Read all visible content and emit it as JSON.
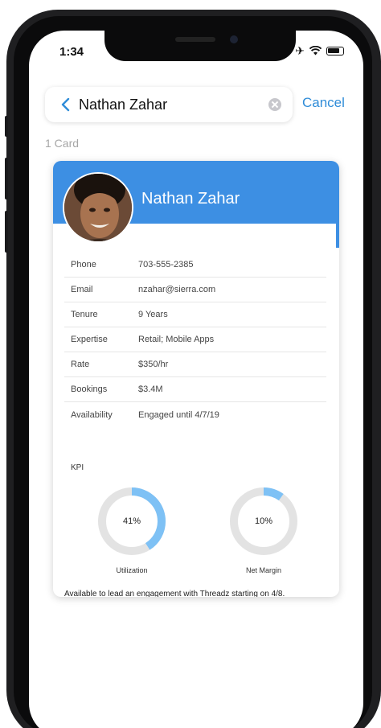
{
  "status_bar": {
    "time": "1:34",
    "airplane_icon": "airplane-icon",
    "wifi_icon": "wifi-icon",
    "battery_icon": "battery-icon"
  },
  "search": {
    "value": "Nathan Zahar",
    "cancel_label": "Cancel",
    "back_icon": "chevron-left-icon",
    "clear_icon": "clear-icon"
  },
  "results": {
    "count_label": "1 Card"
  },
  "card": {
    "name": "Nathan Zahar",
    "header_color": "#3d8fe3",
    "fields": [
      {
        "label": "Phone",
        "value": "703-555-2385"
      },
      {
        "label": "Email",
        "value": "nzahar@sierra.com"
      },
      {
        "label": "Tenure",
        "value": "9 Years"
      },
      {
        "label": "Expertise",
        "value": "Retail; Mobile Apps"
      },
      {
        "label": "Rate",
        "value": "$350/hr"
      },
      {
        "label": "Bookings",
        "value": "$3.4M"
      },
      {
        "label": "Availability",
        "value": "Engaged until 4/7/19"
      }
    ],
    "kpi": {
      "label": "KPI",
      "gauges": [
        {
          "label": "Utilization",
          "value": 41,
          "display": "41%"
        },
        {
          "label": "Net Margin",
          "value": 10,
          "display": "10%"
        }
      ],
      "track_color": "#e3e3e3",
      "fill_color": "#7ec1f5"
    },
    "note": "Available to lead an engagement with Threadz starting on 4/8."
  }
}
